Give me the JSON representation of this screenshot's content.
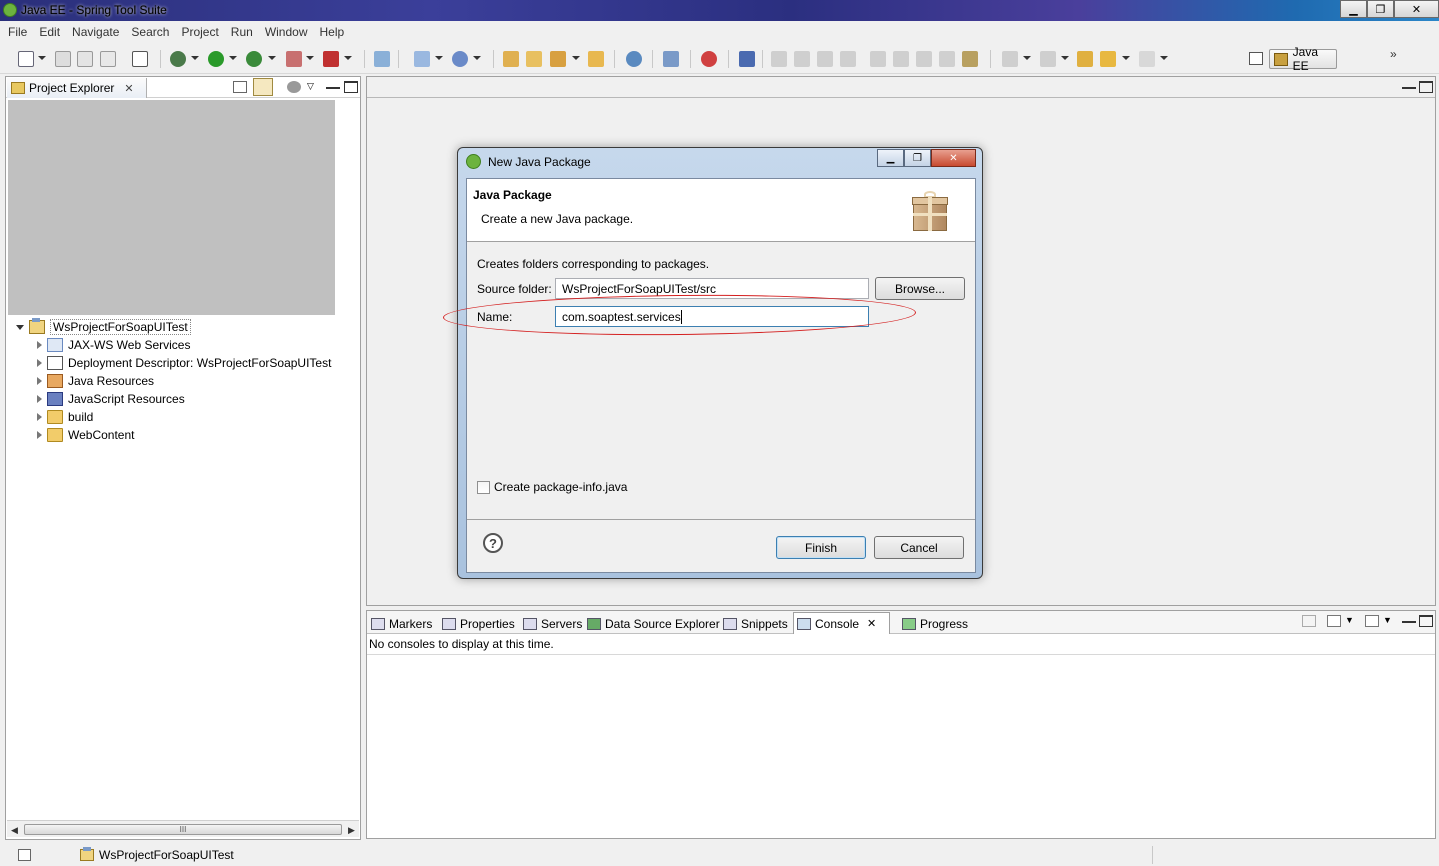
{
  "window": {
    "title": "Java EE - Spring Tool Suite",
    "minimize": "▁",
    "restore": "❐",
    "close": "✕"
  },
  "menu": [
    "File",
    "Edit",
    "Navigate",
    "Search",
    "Project",
    "Run",
    "Window",
    "Help"
  ],
  "perspective": {
    "label": "Java EE",
    "more": "»"
  },
  "project_explorer": {
    "tab_label": "Project Explorer",
    "tab_close": "✕",
    "tree": [
      {
        "label": "WsProjectForSoapUITest",
        "icon": "project-icon",
        "expanded": true,
        "level": 0
      },
      {
        "label": "JAX-WS Web Services",
        "icon": "web-services-icon",
        "level": 1
      },
      {
        "label": "Deployment Descriptor: WsProjectForSoapUITest",
        "icon": "deployment-descriptor-icon",
        "level": 1
      },
      {
        "label": "Java Resources",
        "icon": "java-resources-icon",
        "level": 1
      },
      {
        "label": "JavaScript Resources",
        "icon": "javascript-resources-icon",
        "level": 1
      },
      {
        "label": "build",
        "icon": "folder-icon",
        "level": 1
      },
      {
        "label": "WebContent",
        "icon": "folder-icon",
        "level": 1
      }
    ],
    "scroll_thumb": "III"
  },
  "console_view": {
    "tabs": [
      "Markers",
      "Properties",
      "Servers",
      "Data Source Explorer",
      "Snippets",
      "Console",
      "Progress"
    ],
    "active_tab": "Console",
    "tab_close": "✕",
    "message": "No consoles to display at this time."
  },
  "status": {
    "project": "WsProjectForSoapUITest"
  },
  "dialog": {
    "title": "New Java Package",
    "heading": "Java Package",
    "description": "Create a new Java package.",
    "info": "Creates folders corresponding to packages.",
    "source_folder_label": "Source folder:",
    "source_folder_value": "WsProjectForSoapUITest/src",
    "browse_label": "Browse...",
    "name_label": "Name:",
    "name_value": "com.soaptest.services",
    "checkbox_label": "Create package-info.java",
    "checkbox_checked": false,
    "help_glyph": "?",
    "finish_label": "Finish",
    "cancel_label": "Cancel",
    "min_glyph": "▁",
    "restore_glyph": "❐",
    "close_glyph": "✕"
  },
  "colors": {
    "accent": "#3c7fb1",
    "annotation": "#d42020"
  }
}
